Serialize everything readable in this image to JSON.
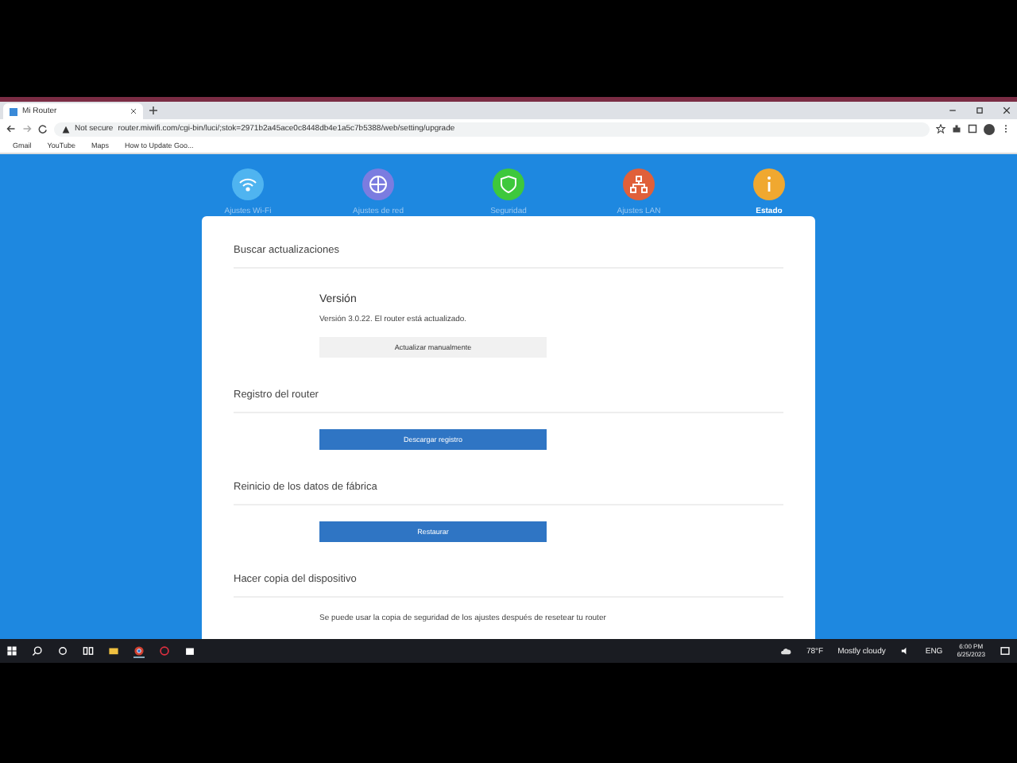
{
  "browser": {
    "tab_title": "Mi Router",
    "security": "Not secure",
    "url": "router.miwifi.com/cgi-bin/luci/;stok=2971b2a45ace0c8448db4e1a5c7b5388/web/setting/upgrade",
    "bookmarks": [
      "Gmail",
      "YouTube",
      "Maps",
      "How to Update Goo..."
    ]
  },
  "nav": [
    {
      "label": "Ajustes Wi-Fi",
      "color": "#4fb4f0",
      "kind": "wifi",
      "selected": false
    },
    {
      "label": "Ajustes de red",
      "color": "#7b7ce0",
      "kind": "globe",
      "selected": false
    },
    {
      "label": "Seguridad",
      "color": "#3ec83c",
      "kind": "shield",
      "selected": false
    },
    {
      "label": "Ajustes LAN",
      "color": "#e0603a",
      "kind": "lan",
      "selected": false
    },
    {
      "label": "Estado",
      "color": "#f0a830",
      "kind": "info",
      "selected": true
    }
  ],
  "sections": [
    {
      "title": "Buscar actualizaciones",
      "heading": "Versión",
      "text": "Versión 3.0.22. El router está actualizado.",
      "button": "Actualizar manualmente",
      "primary": false
    },
    {
      "title": "Registro del router",
      "button": "Descargar registro",
      "primary": true
    },
    {
      "title": "Reinicio de los datos de fábrica",
      "button": "Restaurar",
      "primary": true
    },
    {
      "title": "Hacer copia del dispositivo",
      "text": "Se puede usar la copia de seguridad de los ajustes después de resetear tu router"
    }
  ],
  "taskbar": {
    "weather": "78°F",
    "condition": "Mostly cloudy",
    "language": "ENG",
    "time": "6:00 PM",
    "date": "6/25/2023"
  }
}
